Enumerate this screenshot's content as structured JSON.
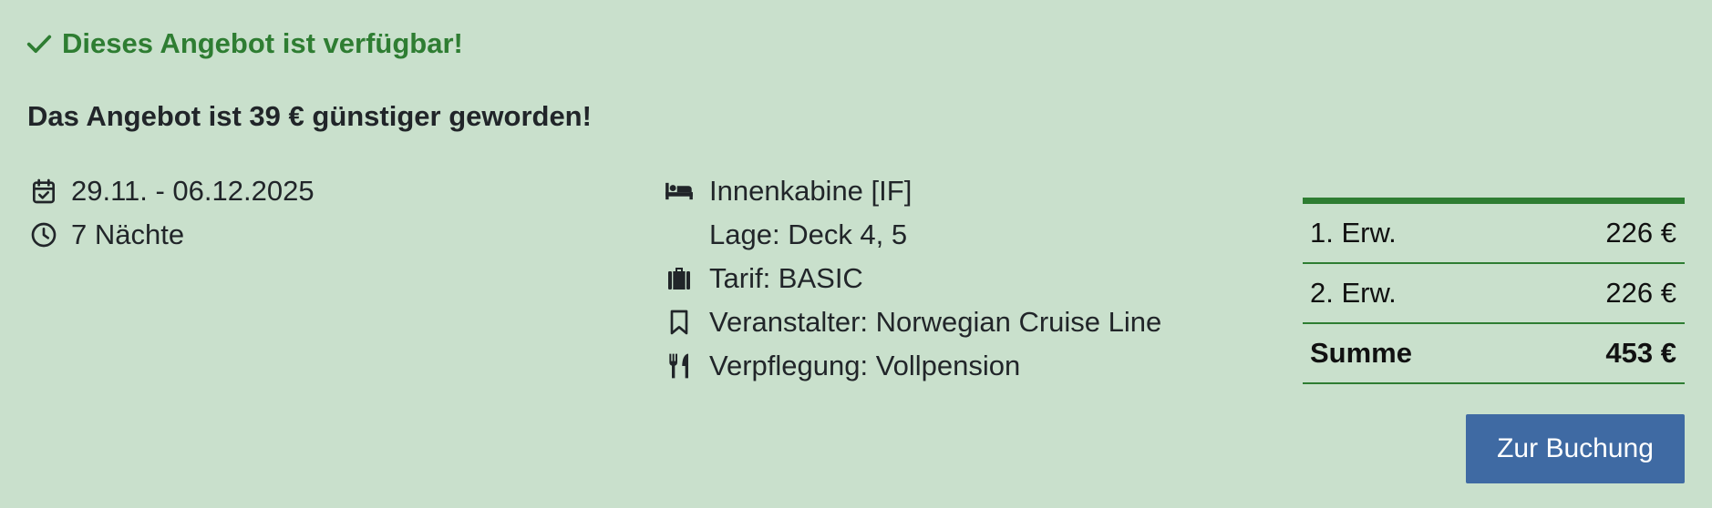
{
  "status": {
    "available_text": "Dieses Angebot ist verfügbar!",
    "cheaper_text": "Das Angebot ist 39 € günstiger geworden!",
    "accent_color": "#2e7d32"
  },
  "trip": {
    "dates": "29.11. - 06.12.2025",
    "nights": "7 Nächte"
  },
  "cabin": {
    "type": "Innenkabine [IF]",
    "location": "Lage: Deck 4, 5",
    "tariff": "Tarif: BASIC",
    "operator": "Veranstalter: Norwegian Cruise Line",
    "board": "Verpflegung: Vollpension"
  },
  "prices": {
    "rows": [
      {
        "label": "1. Erw.",
        "value": "226 €"
      },
      {
        "label": "2. Erw.",
        "value": "226 €"
      }
    ],
    "total_label": "Summe",
    "total_value": "453 €"
  },
  "booking": {
    "button_label": "Zur Buchung",
    "button_color": "#3f6aa3"
  },
  "icons": {
    "available": "check-icon",
    "dates": "calendar-check-icon",
    "nights": "clock-icon",
    "cabin": "bed-icon",
    "tariff": "suitcase-icon",
    "operator": "bookmark-icon",
    "board": "utensils-icon"
  }
}
